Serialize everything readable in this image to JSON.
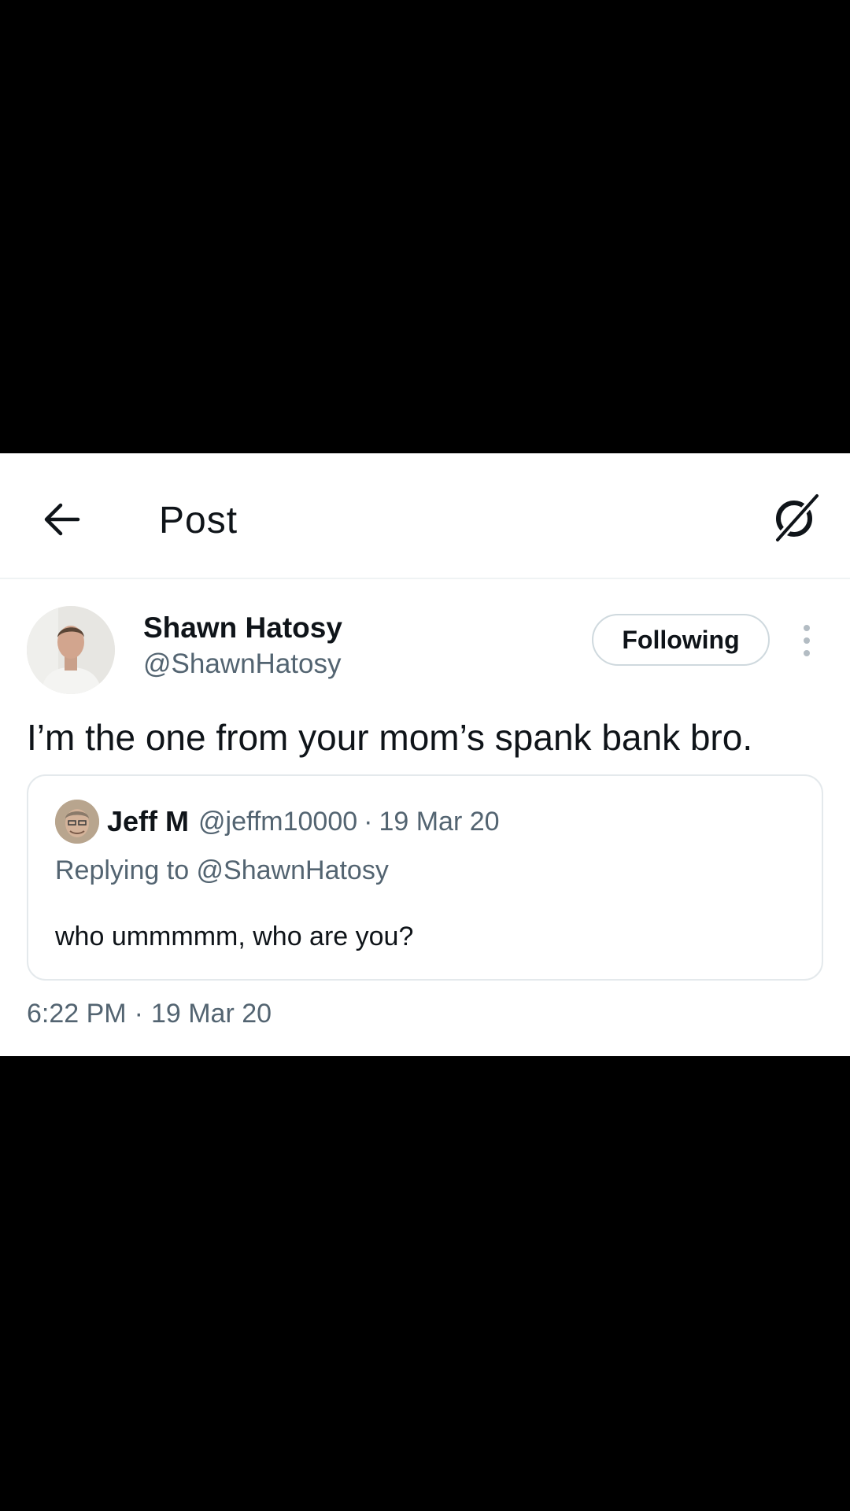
{
  "header": {
    "title": "Post",
    "back_icon": "arrow-left-icon",
    "right_icon": "grok-icon"
  },
  "tweet": {
    "author_name": "Shawn Hatosy",
    "author_handle": "@ShawnHatosy",
    "follow_label": "Following",
    "text": "I’m the one from your mom’s spank bank bro.",
    "time": "6:22 PM",
    "date": "19 Mar 20"
  },
  "quote": {
    "author_name": "Jeff M",
    "author_handle": "@jeffm10000",
    "separator": "·",
    "date": "19 Mar 20",
    "replying_to": "Replying to @ShawnHatosy",
    "text": "who ummmmm, who are you?"
  },
  "colors": {
    "text_primary": "#0f1419",
    "text_secondary": "#536471",
    "border": "#cfd9de",
    "background": "#ffffff"
  }
}
